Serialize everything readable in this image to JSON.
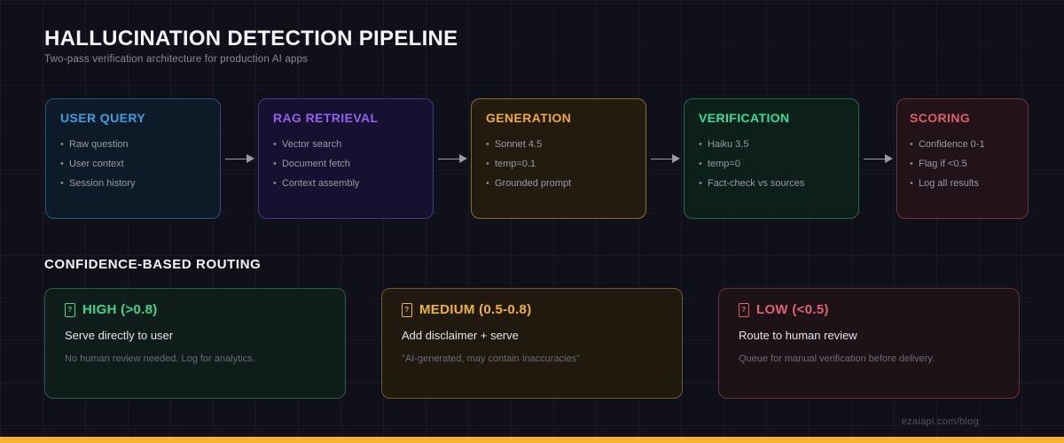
{
  "header": {
    "title": "HALLUCINATION DETECTION PIPELINE",
    "subtitle": "Two-pass verification architecture for production AI apps"
  },
  "pipeline": {
    "arrow_icon": "arrow-right",
    "stages": [
      {
        "title": "USER QUERY",
        "accent": "#3aa0e0",
        "items": [
          "Raw question",
          "User context",
          "Session history"
        ]
      },
      {
        "title": "RAG RETRIEVAL",
        "accent": "#9161f0",
        "items": [
          "Vector search",
          "Document fetch",
          "Context assembly"
        ]
      },
      {
        "title": "GENERATION",
        "accent": "#f0ad2e",
        "items": [
          "Sonnet 4.5",
          "temp=0.1",
          "Grounded prompt"
        ]
      },
      {
        "title": "VERIFICATION",
        "accent": "#2ee0a0",
        "items": [
          "Haiku 3.5",
          "temp=0",
          "Fact-check vs sources"
        ]
      },
      {
        "title": "SCORING",
        "accent": "#e05c66",
        "items": [
          "Confidence 0-1",
          "Flag if <0.5",
          "Log all results"
        ]
      }
    ]
  },
  "routing": {
    "heading": "CONFIDENCE-BASED ROUTING",
    "lanes": [
      {
        "icon": "missing-glyph-box",
        "title": "HIGH (>0.8)",
        "accent": "#3cd68e",
        "action": "Serve directly to user",
        "note": "No human review needed. Log for analytics."
      },
      {
        "icon": "missing-glyph-box",
        "title": "MEDIUM (0.5-0.8)",
        "accent": "#f0b42e",
        "action": "Add disclaimer + serve",
        "note": "\"AI-generated, may contain inaccuracies\""
      },
      {
        "icon": "missing-glyph-box",
        "title": "LOW (<0.5)",
        "accent": "#e06075",
        "action": "Route to human review",
        "note": "Queue for manual verification before delivery."
      }
    ]
  },
  "footer": {
    "watermark": "ezaiapi.com/blog",
    "bar_color": "#f6b42c"
  }
}
